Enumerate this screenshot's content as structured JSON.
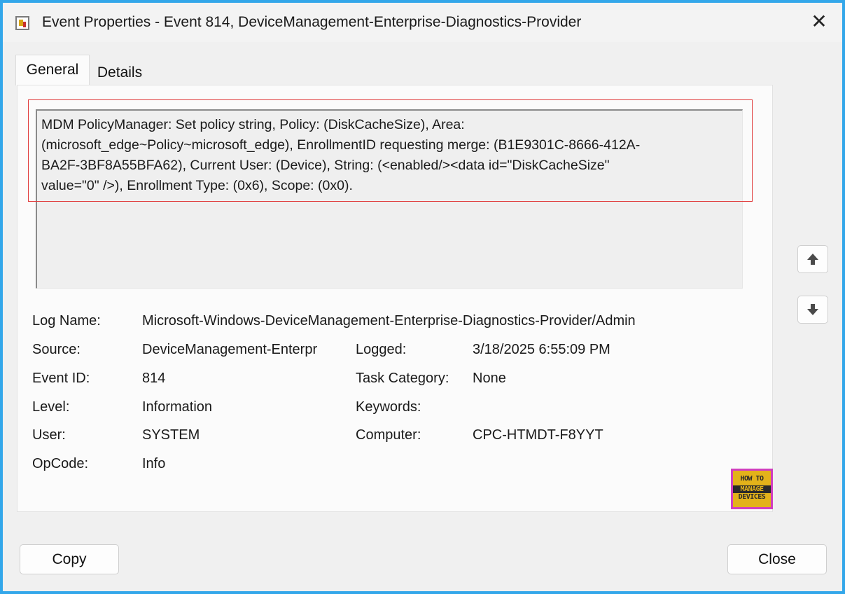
{
  "window": {
    "title": "Event Properties - Event 814, DeviceManagement-Enterprise-Diagnostics-Provider",
    "close_glyph": "✕"
  },
  "tabs": [
    {
      "label": "General",
      "selected": true
    },
    {
      "label": "Details",
      "selected": false
    }
  ],
  "message": {
    "lines": [
      "MDM PolicyManager: Set policy string, Policy: (DiskCacheSize), Area:",
      "(microsoft_edge~Policy~microsoft_edge), EnrollmentID requesting merge: (B1E9301C-8666-412A-",
      "BA2F-3BF8A55BFA62), Current User: (Device), String: (<enabled/><data id=\"DiskCacheSize\"",
      "value=\"0\" />), Enrollment Type: (0x6), Scope: (0x0)."
    ],
    "highlight_color": "#e03a3a"
  },
  "fields": {
    "log_name": {
      "label": "Log Name:",
      "value": "Microsoft-Windows-DeviceManagement-Enterprise-Diagnostics-Provider/Admin"
    },
    "source": {
      "label": "Source:",
      "value": "DeviceManagement-Enterpr"
    },
    "logged": {
      "label": "Logged:",
      "value": "3/18/2025 6:55:09 PM"
    },
    "event_id": {
      "label": "Event ID:",
      "value": "814"
    },
    "task_category": {
      "label": "Task Category:",
      "value": "None"
    },
    "level": {
      "label": "Level:",
      "value": "Information"
    },
    "keywords": {
      "label": "Keywords:",
      "value": ""
    },
    "user": {
      "label": "User:",
      "value": "SYSTEM"
    },
    "computer": {
      "label": "Computer:",
      "value": "CPC-HTMDT-F8YYT"
    },
    "opcode": {
      "label": "OpCode:",
      "value": "Info"
    }
  },
  "nav": {
    "up_icon": "arrow-up-icon",
    "down_icon": "arrow-down-icon"
  },
  "buttons": {
    "copy": "Copy",
    "close": "Close"
  },
  "logo": {
    "line1": "HOW TO",
    "line2": "MANAGE",
    "line3": "DEVICES"
  },
  "colors": {
    "frame_border": "#33a7ea",
    "highlight": "#e03a3a",
    "logo_bg": "#e3b21a",
    "logo_border": "#d13fbf"
  }
}
